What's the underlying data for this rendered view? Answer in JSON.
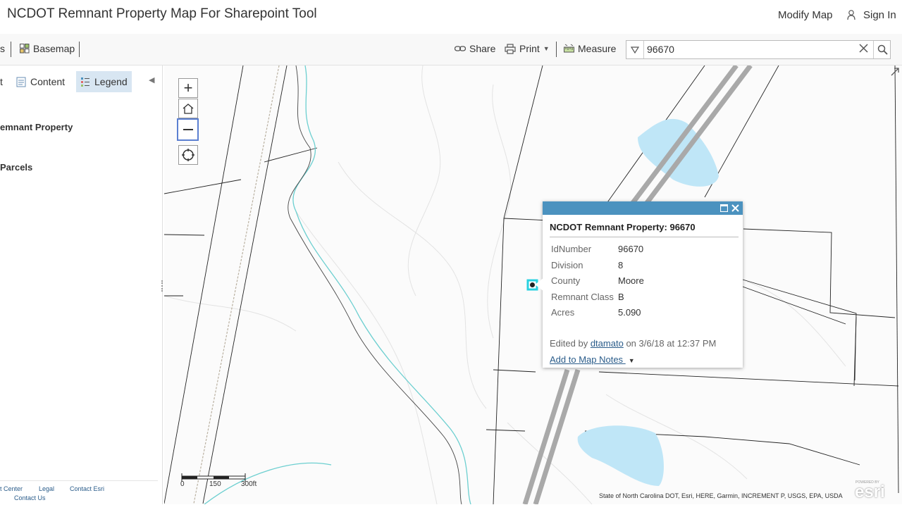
{
  "header": {
    "title": "NCDOT Remnant Property Map For Sharepoint Tool",
    "modify_map": "Modify Map",
    "sign_in": "Sign In"
  },
  "toolbar": {
    "cut_tab": "s",
    "basemap": "Basemap",
    "share": "Share",
    "print": "Print",
    "measure": "Measure"
  },
  "search": {
    "value": "96670"
  },
  "sidepanel": {
    "tabs": [
      "t",
      "Content",
      "Legend"
    ],
    "active_tab": "Legend",
    "layers": [
      "emnant Property",
      "Parcels"
    ],
    "footer_links": [
      "t Center",
      "Legal",
      "Contact Esri",
      "Contact Us"
    ]
  },
  "map": {
    "scale_labels": [
      "0",
      "150",
      "300ft"
    ],
    "attribution": "State of North Carolina DOT, Esri, HERE, Garmin, INCREMENT P, USGS, EPA, USDA",
    "brand": "esri",
    "brand_small": "POWERED BY"
  },
  "popup": {
    "title": "NCDOT Remnant Property: 96670",
    "attributes": [
      {
        "label": "IdNumber",
        "value": "96670"
      },
      {
        "label": "Division",
        "value": "8"
      },
      {
        "label": "County",
        "value": "Moore"
      },
      {
        "label": "Remnant Class",
        "value": "B"
      },
      {
        "label": "Acres",
        "value": "5.090"
      }
    ],
    "edited_prefix": "Edited by",
    "edited_user": "dtamato",
    "edited_suffix": "on 3/6/18 at 12:37 PM",
    "add_notes": "Add to Map Notes"
  },
  "colors": {
    "popup_bar": "#4b92bf",
    "water": "#bfe6f7",
    "stream": "#6ccfd0",
    "highway": "#a9a9a9",
    "legend_active": "#d8e6f2"
  }
}
